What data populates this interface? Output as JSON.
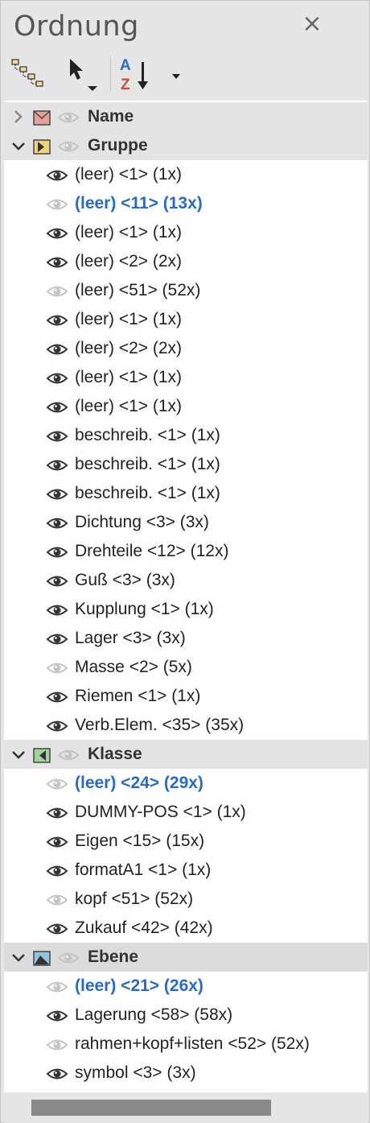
{
  "panel": {
    "title": "Ordnung",
    "close_glyph": "×"
  },
  "toolbar": {
    "hierarchy_icon": "hierarchy-icon",
    "select_icon": "cursor-select-icon",
    "sort_icon": "sort-az-icon",
    "sort_a": "A",
    "sort_z": "Z"
  },
  "groups": [
    {
      "label": "Name",
      "expanded": false,
      "icon": "envelope-icon",
      "items": []
    },
    {
      "label": "Gruppe",
      "expanded": true,
      "icon": "group-flag-icon",
      "items": [
        {
          "label": "(leer) <1> (1x)",
          "visible": true,
          "selected": false
        },
        {
          "label": "(leer) <11> (13x)",
          "visible": false,
          "selected": true
        },
        {
          "label": "(leer) <1> (1x)",
          "visible": true,
          "selected": false
        },
        {
          "label": "(leer) <2> (2x)",
          "visible": true,
          "selected": false
        },
        {
          "label": "(leer) <51> (52x)",
          "visible": false,
          "selected": false
        },
        {
          "label": "(leer) <1> (1x)",
          "visible": true,
          "selected": false
        },
        {
          "label": "(leer) <2> (2x)",
          "visible": true,
          "selected": false
        },
        {
          "label": "(leer) <1> (1x)",
          "visible": true,
          "selected": false
        },
        {
          "label": "(leer) <1> (1x)",
          "visible": true,
          "selected": false
        },
        {
          "label": "beschreib. <1> (1x)",
          "visible": true,
          "selected": false
        },
        {
          "label": "beschreib. <1> (1x)",
          "visible": true,
          "selected": false
        },
        {
          "label": "beschreib. <1> (1x)",
          "visible": true,
          "selected": false
        },
        {
          "label": "Dichtung <3> (3x)",
          "visible": true,
          "selected": false
        },
        {
          "label": "Drehteile <12> (12x)",
          "visible": true,
          "selected": false
        },
        {
          "label": "Guß <3> (3x)",
          "visible": true,
          "selected": false
        },
        {
          "label": "Kupplung <1> (1x)",
          "visible": true,
          "selected": false
        },
        {
          "label": "Lager <3> (3x)",
          "visible": true,
          "selected": false
        },
        {
          "label": "Masse <2> (5x)",
          "visible": false,
          "selected": false
        },
        {
          "label": "Riemen <1> (1x)",
          "visible": true,
          "selected": false
        },
        {
          "label": "Verb.Elem. <35> (35x)",
          "visible": true,
          "selected": false
        }
      ]
    },
    {
      "label": "Klasse",
      "expanded": true,
      "icon": "class-flag-icon",
      "items": [
        {
          "label": "(leer) <24> (29x)",
          "visible": false,
          "selected": true
        },
        {
          "label": "DUMMY-POS <1> (1x)",
          "visible": true,
          "selected": false
        },
        {
          "label": "Eigen <15> (15x)",
          "visible": true,
          "selected": false
        },
        {
          "label": "formatA1 <1> (1x)",
          "visible": true,
          "selected": false
        },
        {
          "label": "kopf <51> (52x)",
          "visible": false,
          "selected": false
        },
        {
          "label": "Zukauf <42> (42x)",
          "visible": true,
          "selected": false
        }
      ]
    },
    {
      "label": "Ebene",
      "expanded": true,
      "icon": "layer-icon",
      "items": [
        {
          "label": "(leer) <21> (26x)",
          "visible": false,
          "selected": true
        },
        {
          "label": "Lagerung <58> (58x)",
          "visible": true,
          "selected": false
        },
        {
          "label": "rahmen+kopf+listen <52> (52x)",
          "visible": false,
          "selected": false
        },
        {
          "label": "symbol <3> (3x)",
          "visible": true,
          "selected": false
        }
      ]
    }
  ],
  "colors": {
    "selected_text": "#2a6bbf",
    "eye_visible": "#333333",
    "eye_hidden": "#c4c4c4"
  }
}
